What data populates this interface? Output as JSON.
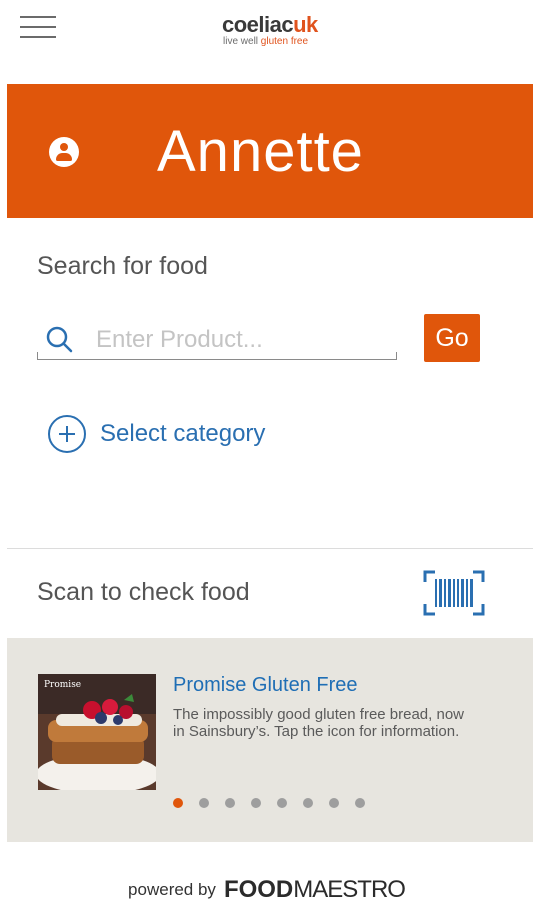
{
  "header": {
    "logo_main_a": "coeliac",
    "logo_main_b": "uk",
    "logo_tag_a": "live well ",
    "logo_tag_b": "gluten free"
  },
  "banner": {
    "name": "Annette",
    "color": "#e0560b"
  },
  "search": {
    "title": "Search for food",
    "placeholder": "Enter Product...",
    "value": "",
    "go_label": "Go"
  },
  "category": {
    "label": "Select category"
  },
  "scan": {
    "title": "Scan to check food"
  },
  "promo": {
    "title": "Promise Gluten Free",
    "description": "The impossibly good gluten free bread, now in Sainsbury’s. Tap the icon for information.",
    "image_brand": "Promise",
    "dots_total": 8,
    "active_dot": 1
  },
  "footer": {
    "powered_by": "powered by",
    "brand_a": "FOOD",
    "brand_b": "MAESTRO"
  },
  "colors": {
    "accent": "#e0560b",
    "link": "#1f6eb5"
  }
}
